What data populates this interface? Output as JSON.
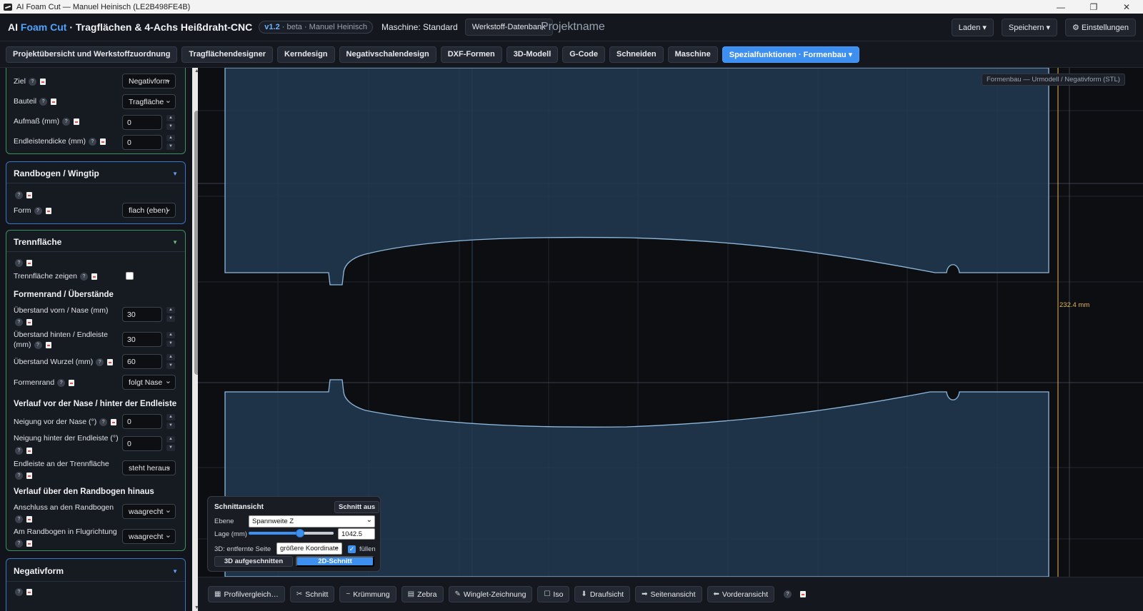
{
  "window": {
    "title": "AI Foam Cut — Manuel Heinisch (LE2B498FE4B)",
    "controls": {
      "minimize": "—",
      "maximize": "❐",
      "close": "✕"
    }
  },
  "header": {
    "brand_ai": "AI",
    "brand_foam": "Foam Cut",
    "brand_rest": "· Tragflächen & 4-Achs Heißdraht-CNC",
    "version": "v1.2",
    "version_suffix": "· beta · Manuel Heinisch",
    "machine": "Maschine: Standard",
    "material_db": "Werkstoff-Datenbank",
    "project_name": "Projektname",
    "load": "Laden ▾",
    "save": "Speichern ▾",
    "settings": "⚙ Einstellungen"
  },
  "tabs": [
    {
      "label": "Projektübersicht und Werkstoffzuordnung",
      "active": false
    },
    {
      "label": "Tragflächendesigner",
      "active": false
    },
    {
      "label": "Kerndesign",
      "active": false
    },
    {
      "label": "Negativschalendesign",
      "active": false
    },
    {
      "label": "DXF-Formen",
      "active": false
    },
    {
      "label": "3D-Modell",
      "active": false
    },
    {
      "label": "G-Code",
      "active": false
    },
    {
      "label": "Schneiden",
      "active": false
    },
    {
      "label": "Maschine",
      "active": false
    },
    {
      "label": "Spezialfunktionen · Formenbau ▾",
      "active": true
    }
  ],
  "sidebar": {
    "top_panel": {
      "ziel_label": "Ziel",
      "ziel_value": "Negativform",
      "bauteil_label": "Bauteil",
      "bauteil_value": "Tragfläche",
      "aufmass_label": "Aufmaß (mm)",
      "aufmass_value": "0",
      "endleiste_label": "Endleistendicke (mm)",
      "endleiste_value": "0"
    },
    "randbogen": {
      "title": "Randbogen / Wingtip",
      "form_label": "Form",
      "form_value": "flach (eben)"
    },
    "trennflaeche": {
      "title": "Trennfläche",
      "show_label": "Trennfläche zeigen",
      "section1": "Formenrand / Überstände",
      "vorn_label": "Überstand vorn / Nase (mm)",
      "vorn_value": "30",
      "hinten_label1": "Überstand hinten / Endleiste",
      "hinten_label2": "(mm)",
      "hinten_value": "30",
      "wurzel_label": "Überstand Wurzel (mm)",
      "wurzel_value": "60",
      "formenrand_label": "Formenrand",
      "formenrand_value": "folgt Nase",
      "section2": "Verlauf vor der Nase / hinter der Endleiste",
      "neigung_vor_label": "Neigung vor der Nase (°)",
      "neigung_vor_value": "0",
      "neigung_hinter_label": "Neigung hinter der Endleiste (°)",
      "neigung_hinter_value": "0",
      "endleiste_trenn_label": "Endleiste an der Trennfläche",
      "endleiste_trenn_value": "steht heraus",
      "section3": "Verlauf über den Randbogen hinaus",
      "anschluss_label": "Anschluss an den Randbogen",
      "anschluss_value": "waagrecht",
      "flugrichtung_label": "Am Randbogen in Flugrichtung",
      "flugrichtung_value": "waagrecht"
    },
    "negativform": {
      "title": "Negativform"
    },
    "help_glyph": "?",
    "chevron": "▼"
  },
  "canvas": {
    "view_label": "Formenbau — Urmodell / Negativform (STL)",
    "dimension": "232.4 mm",
    "colors": {
      "mold": "#233a52",
      "outline": "#8fb8dc",
      "dimension": "#e3b75a",
      "grid": "#22262e"
    }
  },
  "section_view": {
    "title": "Schnittansicht",
    "off_button": "Schnitt aus",
    "plane_label": "Ebene",
    "plane_value": "Spannweite Z",
    "position_label": "Lage (mm)",
    "position_value": "1042.5",
    "slider_fraction": 0.6,
    "far_side_label": "3D: entfernte Seite",
    "far_side_value": "größere Koordinate",
    "fill_label": "füllen",
    "fill_checked": true,
    "btn_3d": "3D aufgeschnitten",
    "btn_2d": "2D-Schnitt"
  },
  "bottom_toolbar": [
    {
      "icon": "▦",
      "label": "Profilvergleich…",
      "name": "profile-compare"
    },
    {
      "icon": "✂",
      "label": "Schnitt",
      "name": "cut"
    },
    {
      "icon": "~",
      "label": "Krümmung",
      "name": "curvature"
    },
    {
      "icon": "▤",
      "label": "Zebra",
      "name": "zebra"
    },
    {
      "icon": "✎",
      "label": "Winglet-Zeichnung",
      "name": "winglet-drawing"
    },
    {
      "icon": "☐",
      "label": "Iso",
      "name": "iso"
    },
    {
      "icon": "⬇",
      "label": "Draufsicht",
      "name": "top-view"
    },
    {
      "icon": "➡",
      "label": "Seitenansicht",
      "name": "side-view"
    },
    {
      "icon": "⬅",
      "label": "Vorderansicht",
      "name": "front-view"
    }
  ]
}
